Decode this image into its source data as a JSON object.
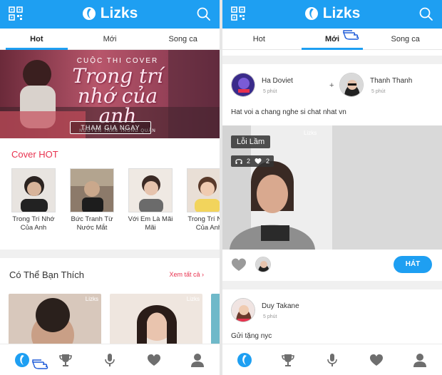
{
  "app": {
    "name": "Lizks"
  },
  "colors": {
    "brand": "#1e9ff2",
    "accent_red": "#e8314e"
  },
  "left": {
    "tabs": [
      {
        "label": "Hot",
        "active": true
      },
      {
        "label": "Mới",
        "active": false
      },
      {
        "label": "Song ca",
        "active": false
      }
    ],
    "banner": {
      "kicker": "CUỘC THI COVER",
      "title": "Trong trí nhớ của anh",
      "author": "NGUYỄN TRẦN TRUNG QUÂN",
      "cta": "THAM GIA NGAY"
    },
    "cover_hot": {
      "title": "Cover HOT",
      "items": [
        {
          "title": "Trong Trí Nhớ Của Anh"
        },
        {
          "title": "Bức Tranh Từ Nước Mắt"
        },
        {
          "title": "Với Em Là Mãi Mãi"
        },
        {
          "title": "Trong Trí Nhớ Của Anh"
        }
      ]
    },
    "suggest": {
      "title": "Có Thể Bạn Thích",
      "see_all": "Xem tất cả",
      "card_watermark": "Lizks"
    }
  },
  "right": {
    "tabs": [
      {
        "label": "Hot",
        "active": false
      },
      {
        "label": "Mới",
        "active": true
      },
      {
        "label": "Song ca",
        "active": false
      }
    ],
    "post1": {
      "user1": {
        "name": "Ha Doviet",
        "time": "5 phút"
      },
      "plus": "+",
      "user2": {
        "name": "Thanh Thanh",
        "time": "5 phút"
      },
      "caption": "Hat voi a chang nghe si chat nhat vn",
      "song": "Lỗi Lầm",
      "listens": "2",
      "likes": "2",
      "watermark": "Lizks",
      "sing_button": "HÁT"
    },
    "post2": {
      "user": {
        "name": "Duy Takane",
        "time": "5 phút"
      },
      "caption": "Gửi tặng nyc"
    }
  },
  "icons": {
    "nav": [
      "home-icon",
      "trophy-icon",
      "microphone-icon",
      "heart-icon",
      "profile-icon"
    ],
    "header": [
      "qr-code-icon",
      "lizks-logo-icon",
      "search-icon"
    ]
  }
}
